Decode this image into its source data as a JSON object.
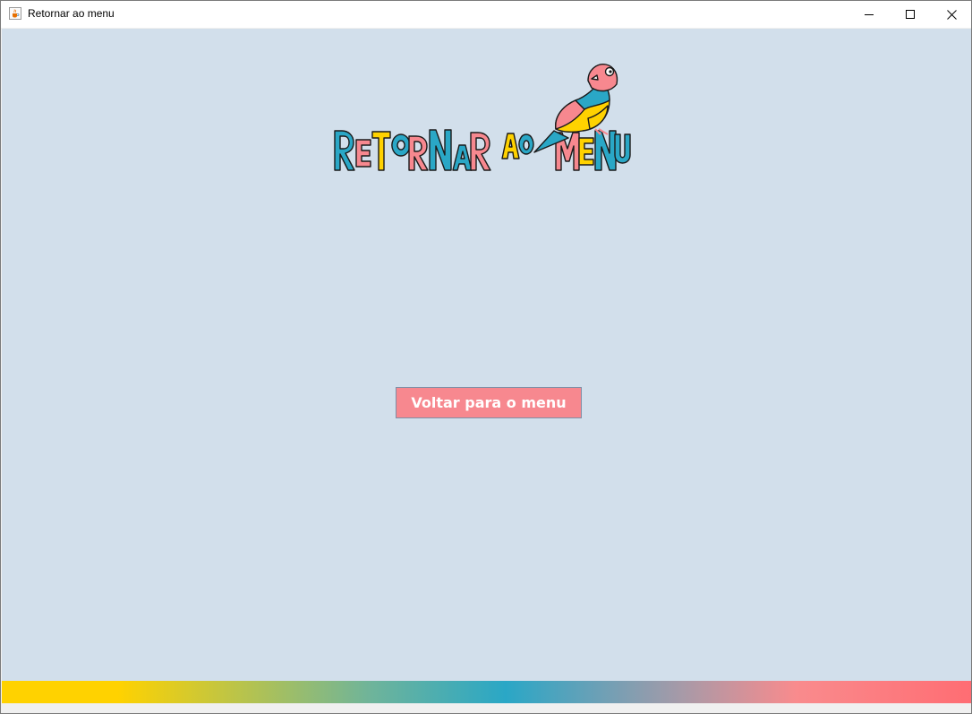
{
  "window": {
    "title": "Retornar ao menu",
    "icon": "java-cup-icon",
    "controls": [
      "minimize-icon",
      "maximize-icon",
      "close-icon"
    ]
  },
  "header": {
    "logo_text": "RETORNAR AO MENU",
    "logo_icon": "bird-icon",
    "colors": [
      "#2aa7c6",
      "#f7888f",
      "#ffd200"
    ]
  },
  "main": {
    "back_button_label": "Voltar para o menu"
  },
  "colors": {
    "background": "#d2dfeb",
    "button": "#f7888f",
    "gradient": [
      "#ffd200",
      "#2aa7c6",
      "#ff6d73"
    ]
  }
}
